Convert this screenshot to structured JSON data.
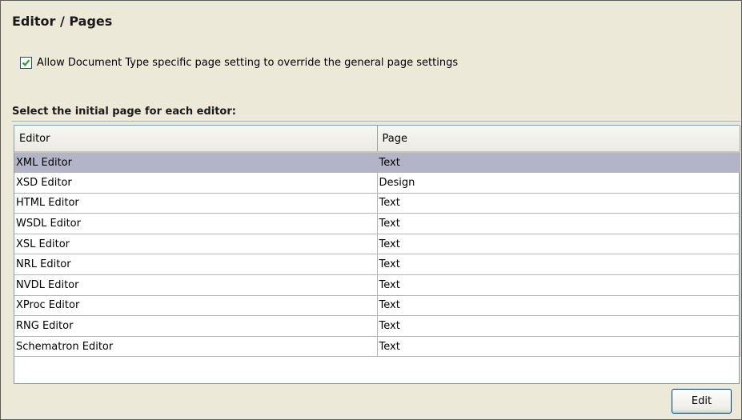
{
  "page": {
    "title": "Editor / Pages"
  },
  "override_option": {
    "checked": true,
    "label": "Allow Document Type specific page setting to override the general page settings"
  },
  "section_label": "Select the initial page for each editor:",
  "table": {
    "columns": [
      "Editor",
      "Page"
    ],
    "rows": [
      {
        "editor": "XML Editor",
        "page": "Text",
        "selected": true
      },
      {
        "editor": "XSD Editor",
        "page": "Design"
      },
      {
        "editor": "HTML Editor",
        "page": "Text"
      },
      {
        "editor": "WSDL Editor",
        "page": "Text"
      },
      {
        "editor": "XSL Editor",
        "page": "Text"
      },
      {
        "editor": "NRL Editor",
        "page": "Text"
      },
      {
        "editor": "NVDL Editor",
        "page": "Text"
      },
      {
        "editor": "XProc Editor",
        "page": "Text"
      },
      {
        "editor": "RNG Editor",
        "page": "Text"
      },
      {
        "editor": "Schematron Editor",
        "page": "Text"
      }
    ]
  },
  "buttons": {
    "edit_label": "Edit"
  },
  "colors": {
    "panel_bg": "#ece9d8",
    "selected_row": "#b4b4c8",
    "check_green": "#21a121"
  }
}
